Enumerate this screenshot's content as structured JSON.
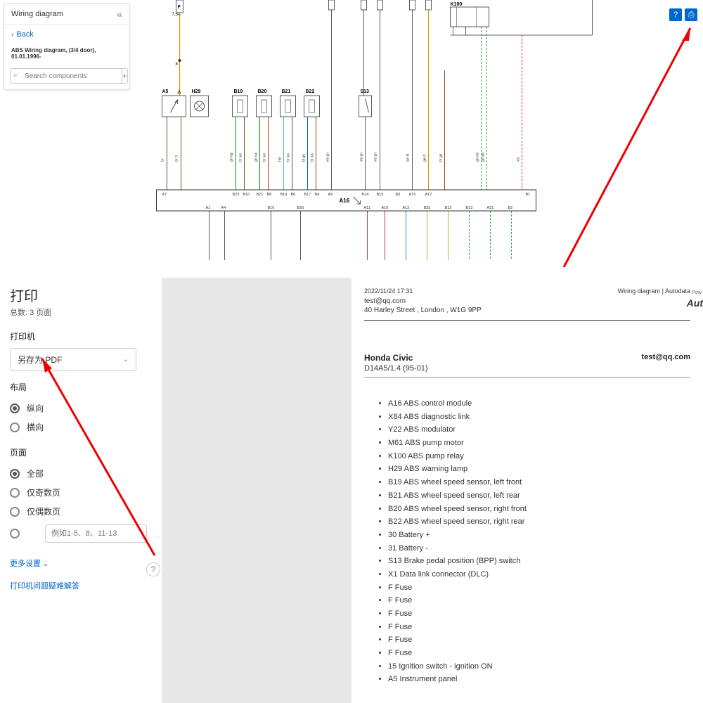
{
  "sidebar": {
    "title": "Wiring diagram",
    "back": "Back",
    "diagram_name": "ABS Wiring diagram, (3/4 door), 01.01.1996-",
    "search_placeholder": "Search components"
  },
  "diagram": {
    "top_labels": [
      "F",
      "K100"
    ],
    "fuse_rating": "7,5A",
    "component_boxes": [
      "A5",
      "H29",
      "B19",
      "B20",
      "B21",
      "B22",
      "S13"
    ],
    "module_label": "A16",
    "top_pins": [
      "A7",
      "B23",
      "B10",
      "B21",
      "B8",
      "B19",
      "B6",
      "B17",
      "B4",
      "A9",
      "B14",
      "B15",
      "B3",
      "A19",
      "A17",
      "B1"
    ],
    "bottom_pins": [
      "A1",
      "A4",
      "B16",
      "B26",
      "A11",
      "A10",
      "A12",
      "B25",
      "B12",
      "B13",
      "A21",
      "B2"
    ],
    "wire_labels": [
      "br",
      "br rt",
      "gn og",
      "br ws",
      "gn sw",
      "br ws",
      "hbl",
      "br ws",
      "bl gn",
      "br ws",
      "ws gn",
      "ws gn",
      "ws gn",
      "sw bl",
      "ge rt",
      "br ge",
      "gn ws",
      "gn ws",
      "ws"
    ]
  },
  "print": {
    "title": "打印",
    "subtitle": "总数: 3 页面",
    "printer_label": "打印机",
    "printer_value": "另存为 PDF",
    "layout_label": "布局",
    "layout_portrait": "纵向",
    "layout_landscape": "横向",
    "pages_label": "页面",
    "pages_all": "全部",
    "pages_odd": "仅奇数页",
    "pages_even": "仅偶数页",
    "pages_placeholder": "例如1-5、8、11-13",
    "more_settings": "更多设置",
    "troubleshoot": "打印机问题疑难解答"
  },
  "preview": {
    "datetime": "2022/11/24 17:31",
    "header_right": "Wiring diagram | Autodata",
    "email": "test@qq.com",
    "address": "40 Harley Street , London , W1G 9PP",
    "powered": "Pow",
    "logo": "Aut",
    "vehicle": "Honda Civic",
    "model": "D14A5/1.4 (95-01)",
    "components": [
      "A16 ABS control module",
      "X84 ABS diagnostic link",
      "Y22 ABS modulator",
      "M61 ABS pump motor",
      "K100 ABS pump relay",
      "H29 ABS warning lamp",
      "B19 ABS wheel speed sensor, left front",
      "B21 ABS wheel speed sensor, left rear",
      "B20 ABS wheel speed sensor, right front",
      "B22 ABS wheel speed sensor, right rear",
      "30 Battery +",
      "31 Battery -",
      "S13 Brake pedal position (BPP) switch",
      "X1 Data link connector (DLC)",
      "F Fuse",
      "F Fuse",
      "F Fuse",
      "F Fuse",
      "F Fuse",
      "F Fuse",
      "15 Ignition switch - ignition ON",
      "A5 Instrument panel"
    ]
  }
}
